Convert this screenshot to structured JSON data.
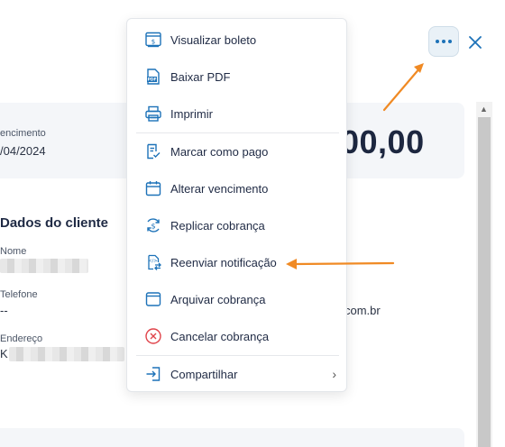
{
  "summary": {
    "vencimento_label": "encimento",
    "vencimento_value": "/04/2024",
    "amount": "00,00"
  },
  "client": {
    "section_title": "Dados do cliente",
    "nome_label": "Nome",
    "telefone_label": "Telefone",
    "telefone_value": "--",
    "endereco_label": "Endereço",
    "endereco_value_prefix": "K",
    "email_tail": "com.br"
  },
  "header": {
    "more_icon": "more-horizontal-icon",
    "close_icon": "close-icon"
  },
  "menu": {
    "items": [
      {
        "label": "Visualizar boleto",
        "icon": "boleto-icon"
      },
      {
        "label": "Baixar PDF",
        "icon": "pdf-icon"
      },
      {
        "label": "Imprimir",
        "icon": "printer-icon"
      },
      {
        "label": "Marcar como pago",
        "icon": "mark-paid-icon"
      },
      {
        "label": "Alterar vencimento",
        "icon": "calendar-icon"
      },
      {
        "label": "Replicar cobrança",
        "icon": "replicate-icon"
      },
      {
        "label": "Reenviar notificação",
        "icon": "resend-icon"
      },
      {
        "label": "Arquivar cobrança",
        "icon": "archive-icon"
      },
      {
        "label": "Cancelar cobrança",
        "icon": "cancel-icon"
      },
      {
        "label": "Compartilhar",
        "icon": "share-icon"
      }
    ],
    "submenu_indicator": "›"
  },
  "colors": {
    "icon_blue": "#1d72b8",
    "cancel_red": "#e0434a",
    "annotation_orange": "#f08a24"
  }
}
